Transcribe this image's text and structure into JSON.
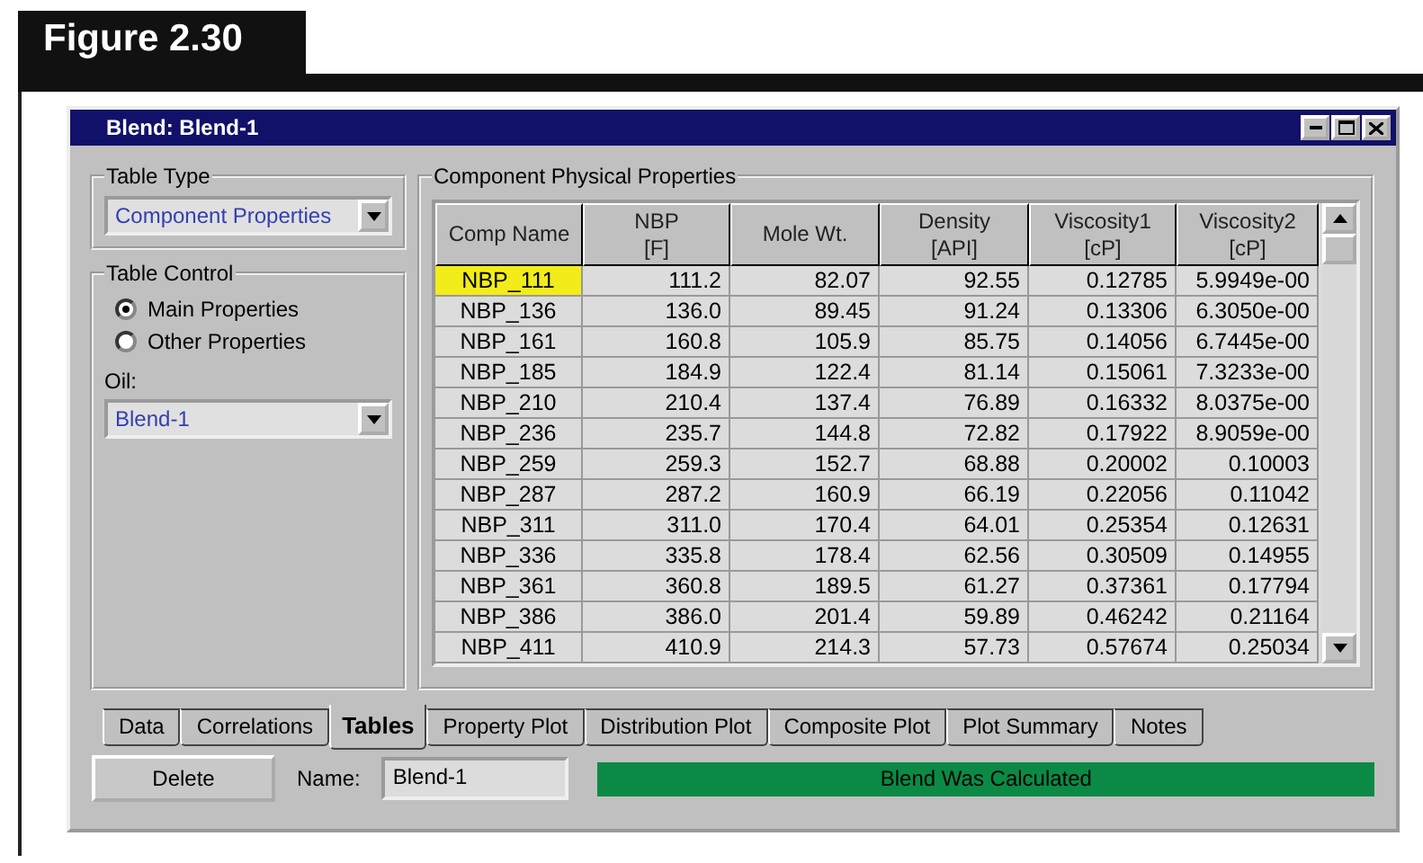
{
  "figure": {
    "title": "Figure 2.30"
  },
  "window": {
    "title": "Blend: Blend-1"
  },
  "table_type": {
    "label": "Table Type",
    "value": "Component Properties"
  },
  "table_control": {
    "label": "Table Control",
    "options": [
      {
        "label": "Main Properties",
        "selected": true
      },
      {
        "label": "Other Properties",
        "selected": false
      }
    ],
    "oil_label": "Oil:",
    "oil_value": "Blend-1"
  },
  "table": {
    "title": "Component Physical Properties",
    "columns": [
      {
        "name": "Comp Name"
      },
      {
        "name": "NBP",
        "unit": "[F]"
      },
      {
        "name": "Mole Wt."
      },
      {
        "name": "Density",
        "unit": "[API]"
      },
      {
        "name": "Viscosity1",
        "unit": "[cP]"
      },
      {
        "name": "Viscosity2",
        "unit": "[cP]"
      }
    ],
    "rows": [
      {
        "selected": true,
        "cells": [
          "NBP_111",
          "111.2",
          "82.07",
          "92.55",
          "0.12785",
          "5.9949e-00"
        ]
      },
      {
        "selected": false,
        "cells": [
          "NBP_136",
          "136.0",
          "89.45",
          "91.24",
          "0.13306",
          "6.3050e-00"
        ]
      },
      {
        "selected": false,
        "cells": [
          "NBP_161",
          "160.8",
          "105.9",
          "85.75",
          "0.14056",
          "6.7445e-00"
        ]
      },
      {
        "selected": false,
        "cells": [
          "NBP_185",
          "184.9",
          "122.4",
          "81.14",
          "0.15061",
          "7.3233e-00"
        ]
      },
      {
        "selected": false,
        "cells": [
          "NBP_210",
          "210.4",
          "137.4",
          "76.89",
          "0.16332",
          "8.0375e-00"
        ]
      },
      {
        "selected": false,
        "cells": [
          "NBP_236",
          "235.7",
          "144.8",
          "72.82",
          "0.17922",
          "8.9059e-00"
        ]
      },
      {
        "selected": false,
        "cells": [
          "NBP_259",
          "259.3",
          "152.7",
          "68.88",
          "0.20002",
          "0.10003"
        ]
      },
      {
        "selected": false,
        "cells": [
          "NBP_287",
          "287.2",
          "160.9",
          "66.19",
          "0.22056",
          "0.11042"
        ]
      },
      {
        "selected": false,
        "cells": [
          "NBP_311",
          "311.0",
          "170.4",
          "64.01",
          "0.25354",
          "0.12631"
        ]
      },
      {
        "selected": false,
        "cells": [
          "NBP_336",
          "335.8",
          "178.4",
          "62.56",
          "0.30509",
          "0.14955"
        ]
      },
      {
        "selected": false,
        "cells": [
          "NBP_361",
          "360.8",
          "189.5",
          "61.27",
          "0.37361",
          "0.17794"
        ]
      },
      {
        "selected": false,
        "cells": [
          "NBP_386",
          "386.0",
          "201.4",
          "59.89",
          "0.46242",
          "0.21164"
        ]
      },
      {
        "selected": false,
        "cells": [
          "NBP_411",
          "410.9",
          "214.3",
          "57.73",
          "0.57674",
          "0.25034"
        ]
      }
    ]
  },
  "tabs": [
    {
      "label": "Data",
      "selected": false
    },
    {
      "label": "Correlations",
      "selected": false
    },
    {
      "label": "Tables",
      "selected": true
    },
    {
      "label": "Property Plot",
      "selected": false
    },
    {
      "label": "Distribution Plot",
      "selected": false
    },
    {
      "label": "Composite Plot",
      "selected": false
    },
    {
      "label": "Plot Summary",
      "selected": false
    },
    {
      "label": "Notes",
      "selected": false
    }
  ],
  "footer": {
    "button": "Delete",
    "name_label": "Name:",
    "name_value": "Blend-1",
    "status": "Blend Was Calculated"
  }
}
